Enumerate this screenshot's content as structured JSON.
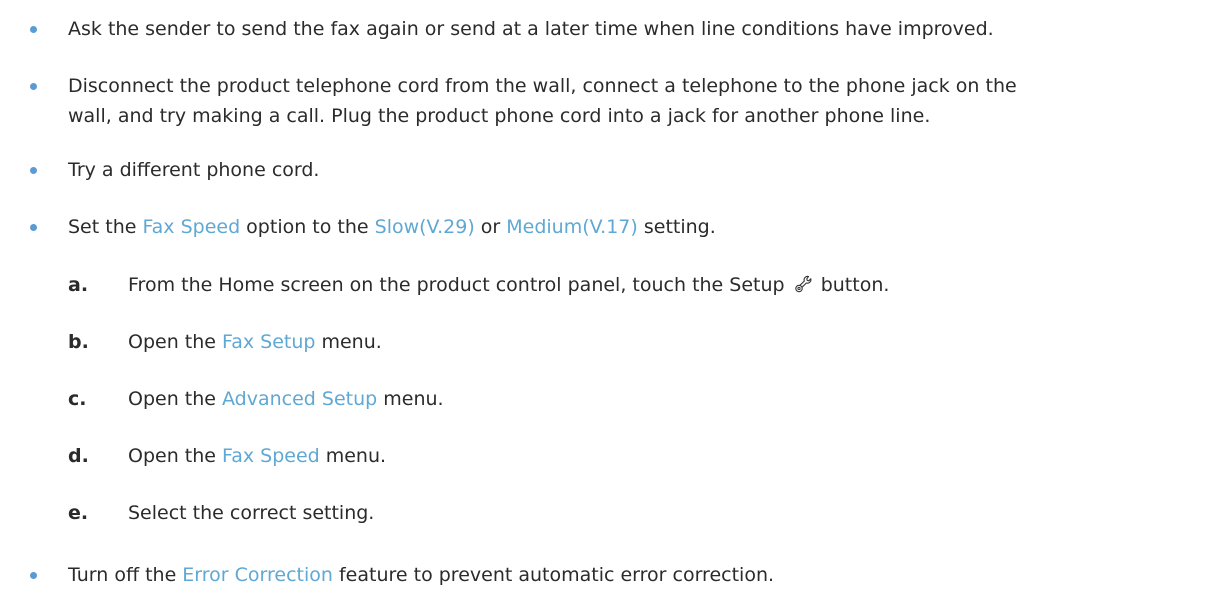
{
  "bullets": [
    {
      "text": "Ask the sender to send the fax again or send at a later time when line conditions have improved."
    },
    {
      "line1": "Disconnect the product telephone cord from the wall, connect a telephone to the phone jack on the",
      "line2": "wall, and try making a call. Plug the product phone cord into a jack for another phone line."
    },
    {
      "text": "Try a different phone cord."
    },
    {
      "pre": "Set the ",
      "link1": "Fax Speed",
      "mid1": " option to the ",
      "link2": "Slow(V.29)",
      "mid2": " or ",
      "link3": "Medium(V.17)",
      "post": " setting."
    },
    {
      "pre": "Turn off the ",
      "link": "Error Correction",
      "post": " feature to prevent automatic error correction."
    }
  ],
  "steps": [
    {
      "letter": "a.",
      "pre": "From the Home screen on the product control panel, touch the Setup",
      "icon": "setup-wrench-icon",
      "post": "button."
    },
    {
      "letter": "b.",
      "pre": "Open the ",
      "link": "Fax Setup",
      "post": " menu."
    },
    {
      "letter": "c.",
      "pre": "Open the ",
      "link": "Advanced Setup",
      "post": " menu."
    },
    {
      "letter": "d.",
      "pre": "Open the ",
      "link": "Fax Speed",
      "post": " menu."
    },
    {
      "letter": "e.",
      "text": "Select the correct setting."
    }
  ],
  "colors": {
    "link": "#5fa8d3",
    "bullet": "#5b9bd5",
    "text": "#2b2b2b"
  }
}
